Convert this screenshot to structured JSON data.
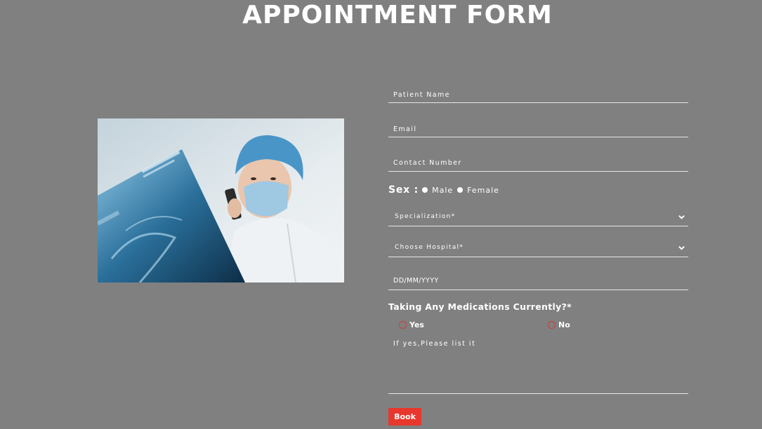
{
  "header": {
    "title": "APPOINTMENT FORM"
  },
  "form": {
    "patient_name": {
      "placeholder": "Patient Name"
    },
    "email": {
      "placeholder": "Email"
    },
    "contact": {
      "placeholder": "Contact Number"
    },
    "sex": {
      "label": "Sex :",
      "options": [
        "Male",
        "Female"
      ]
    },
    "specialization": {
      "selected": "Specialization*"
    },
    "hospital": {
      "selected": "Choose Hospital*"
    },
    "date": {
      "placeholder": "DD/MM/YYYY"
    },
    "medications": {
      "question": "Taking Any Medications Currently?*",
      "options": [
        "Yes",
        "No"
      ],
      "details_placeholder": "If yes,Please list it"
    },
    "submit_label": "Book"
  },
  "colors": {
    "background": "#808080",
    "accent": "#e8372c",
    "radio_ring": "#c9403a"
  },
  "icons": {
    "select_arrow": "chevron-down-icon"
  }
}
